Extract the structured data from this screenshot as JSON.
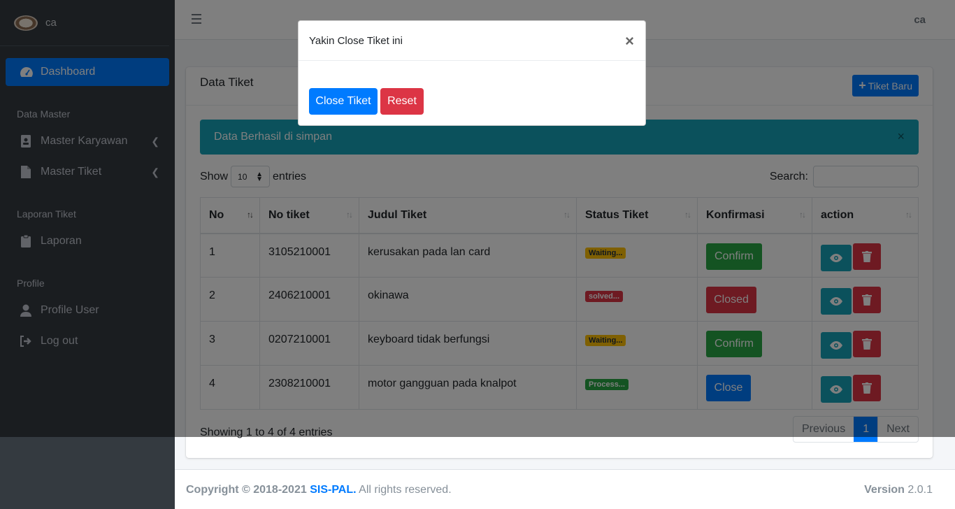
{
  "brand": {
    "name": "ca"
  },
  "sidebar": {
    "dashboard": "Dashboard",
    "section_master": "Data Master",
    "master_karyawan": "Master Karyawan",
    "master_tiket": "Master Tiket",
    "section_laporan": "Laporan Tiket",
    "laporan": "Laporan",
    "section_profile": "Profile",
    "profile_user": "Profile User",
    "logout": "Log out"
  },
  "topbar": {
    "user": "ca"
  },
  "card": {
    "title": "Data Tiket",
    "new_button": "Tiket Baru",
    "alert": "Data Berhasil di simpan",
    "alert_close": "×",
    "show_label": "Show",
    "entries_value": "10",
    "entries_label": "entries",
    "search_label": "Search:",
    "info": "Showing 1 to 4 of 4 entries",
    "pager": {
      "prev": "Previous",
      "current": "1",
      "next": "Next"
    }
  },
  "table": {
    "headers": [
      "No",
      "No tiket",
      "Judul Tiket",
      "Status Tiket",
      "Konfirmasi",
      "action"
    ],
    "rows": [
      {
        "no": "1",
        "tiket": "3105210001",
        "judul": "kerusakan pada lan card",
        "status": "Waiting...",
        "status_type": "warning",
        "action": "Confirm",
        "action_type": "green"
      },
      {
        "no": "2",
        "tiket": "2406210001",
        "judul": "okinawa",
        "status": "solved...",
        "status_type": "danger",
        "action": "Closed",
        "action_type": "red"
      },
      {
        "no": "3",
        "tiket": "0207210001",
        "judul": "keyboard tidak berfungsi",
        "status": "Waiting...",
        "status_type": "warning",
        "action": "Confirm",
        "action_type": "green"
      },
      {
        "no": "4",
        "tiket": "2308210001",
        "judul": "motor gangguan pada knalpot",
        "status": "Process...",
        "status_type": "success",
        "action": "Close",
        "action_type": "blue"
      }
    ]
  },
  "footer": {
    "copyright": "Copyright © 2018-2021",
    "brand_link": "SIS-PAL.",
    "rights": "All rights reserved.",
    "version_label": "Version",
    "version": "2.0.1"
  },
  "modal": {
    "title": "Yakin Close Tiket ini",
    "close": "×",
    "confirm_button": "Close Tiket",
    "reset_button": "Reset"
  }
}
